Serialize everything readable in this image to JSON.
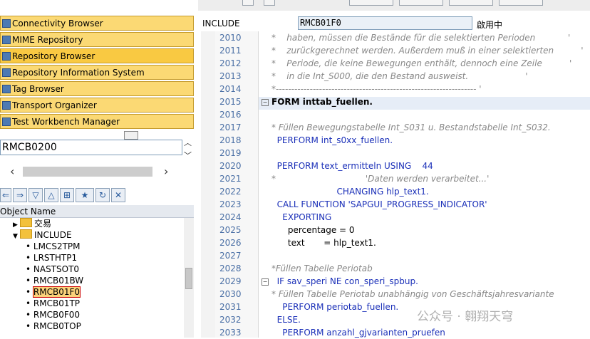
{
  "nav": {
    "buttons": [
      {
        "label": "Connectivity Browser",
        "active": false
      },
      {
        "label": "MIME Repository",
        "active": false
      },
      {
        "label": "Repository Browser",
        "active": true
      },
      {
        "label": "Repository Information System",
        "active": false
      },
      {
        "label": "Tag Browser",
        "active": false
      },
      {
        "label": "Transport Organizer",
        "active": false
      },
      {
        "label": "Test Workbench Manager",
        "active": false
      }
    ]
  },
  "search": {
    "value": "RMCB0200"
  },
  "object_list": {
    "header": "Object Name",
    "folders": [
      "交易",
      "INCLUDE"
    ],
    "items": [
      "LMCS2TPM",
      "LRSTHTP1",
      "NASTSOT0",
      "RMCB01BW",
      "RMCB01F0",
      "RMCB01TP",
      "RMCB0F00",
      "RMCB0TOP"
    ],
    "selected": "RMCB01F0"
  },
  "editor": {
    "include_label": "INCLUDE",
    "include_value": "RMCB01F0",
    "status": "啟用中",
    "lines": [
      {
        "no": "2010",
        "text": "*    haben, müssen die Bestände für die selektierten Perioden            '"
      },
      {
        "no": "2011",
        "text": "*    zurückgerechnet werden. Außerdem muß in einer selektierten          '"
      },
      {
        "no": "2012",
        "text": "*    Periode, die keine Bewegungen enthält, dennoch eine Zeile          '"
      },
      {
        "no": "2013",
        "text": "*    in die Int_S000, die den Bestand ausweist.                     '"
      },
      {
        "no": "2014",
        "text": "*----------------------------------------------------------------- '"
      },
      {
        "no": "2015",
        "text": "FORM inttab_fuellen."
      },
      {
        "no": "2016",
        "text": ""
      },
      {
        "no": "2017",
        "text": "* Füllen Bewegungstabelle Int_S031 u. Bestandstabelle Int_S032."
      },
      {
        "no": "2018",
        "text": "  PERFORM int_s0xx_fuellen."
      },
      {
        "no": "2019",
        "text": ""
      },
      {
        "no": "2020",
        "text": "  PERFORM text_ermitteln USING    44"
      },
      {
        "no": "2021",
        "text": "*                                 'Daten werden verarbeitet...'"
      },
      {
        "no": "2022",
        "text": "                        CHANGING hlp_text1."
      },
      {
        "no": "2023",
        "text": "  CALL FUNCTION 'SAPGUI_PROGRESS_INDICATOR'"
      },
      {
        "no": "2024",
        "text": "    EXPORTING"
      },
      {
        "no": "2025",
        "text": "      percentage = 0"
      },
      {
        "no": "2026",
        "text": "      text       = hlp_text1."
      },
      {
        "no": "2027",
        "text": ""
      },
      {
        "no": "2028",
        "text": "*Füllen Tabelle Periotab"
      },
      {
        "no": "2029",
        "text": "  IF sav_speri NE con_speri_spbup."
      },
      {
        "no": "2030",
        "text": "* Füllen Tabelle Periotab unabhängig von Geschäftsjahresvariante"
      },
      {
        "no": "2031",
        "text": "    PERFORM periotab_fuellen."
      },
      {
        "no": "2032",
        "text": "  ELSE."
      },
      {
        "no": "2033",
        "text": "    PERFORM anzahl_gjvarianten_pruefen"
      }
    ]
  },
  "watermark": "公众号 · 翱翔天穹"
}
